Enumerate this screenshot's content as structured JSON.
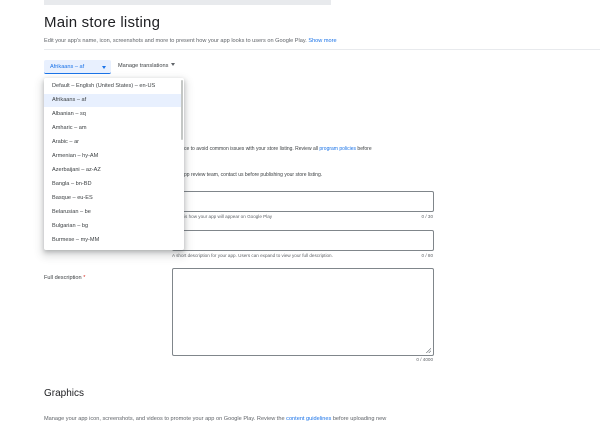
{
  "page": {
    "title": "Main store listing",
    "subtitle": "Edit your app's name, icon, screenshots and more to present how your app looks to users on Google Play.",
    "show_more": "Show more"
  },
  "language_selector": {
    "selected": "Afrikaans – af",
    "manage_translations": "Manage translations",
    "options": [
      "Default – English (United States) – en-US",
      "Afrikaans – af",
      "Albanian – sq",
      "Amharic – am",
      "Arabic – ar",
      "Armenian – hy-AM",
      "Azerbaijani – az-AZ",
      "Bangla – bn-BD",
      "Basque – eu-ES",
      "Belarusian – be",
      "Bulgarian – bg",
      "Burmese – my-MM"
    ],
    "selected_index": 1
  },
  "partial_text": {
    "r_fragment": "r",
    "policy_pre": "ce to avoid common issues with your store listing. Review all",
    "policy_link": "program policies",
    "policy_post": "before",
    "review_fragment": "pp review team, contact us before publishing your store listing."
  },
  "fields": {
    "app_name": {
      "helper": "is how your app will appear on Google Play",
      "counter": "0 / 30"
    },
    "short_description": {
      "helper": "A short description for your app. Users can expand to view your full description.",
      "counter": "0 / 80"
    },
    "full_description": {
      "label": "Full description",
      "required_mark": "*",
      "counter": "0 / 4000"
    }
  },
  "graphics": {
    "title": "Graphics",
    "desc_pre": "Manage your app icon, screenshots, and videos to promote your app on Google Play. Review the",
    "desc_link": "content guidelines",
    "desc_post": "before uploading new"
  },
  "colors": {
    "accent": "#1a73e8",
    "selected_bg": "#e8f0fe",
    "required": "#d93025"
  }
}
